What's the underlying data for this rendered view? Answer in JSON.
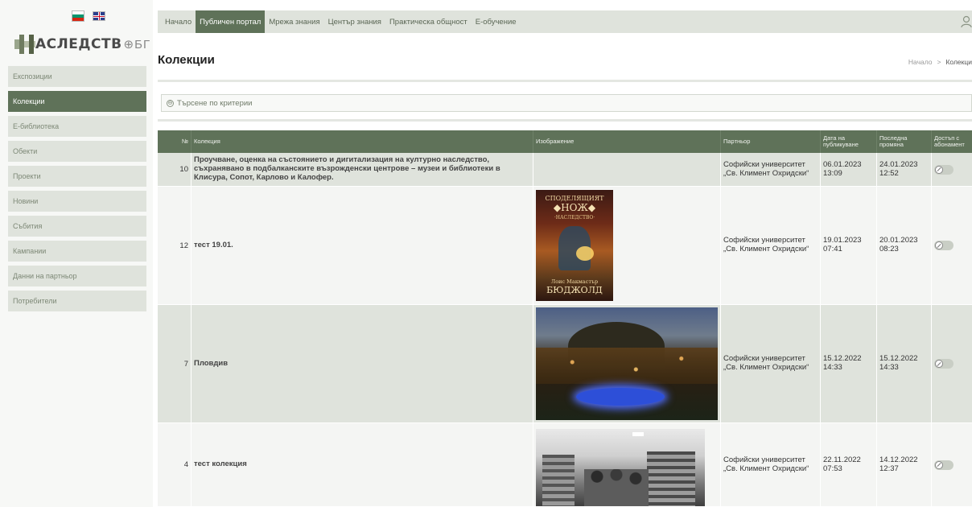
{
  "flags": {
    "bg": "BG",
    "uk": "EN"
  },
  "logo": {
    "text": "АСЛЕДСТВ",
    "suffix": "БГ"
  },
  "sidebar": {
    "items": [
      {
        "label": "Експозиции",
        "active": false
      },
      {
        "label": "Колекции",
        "active": true
      },
      {
        "label": "Е-библиотека",
        "active": false
      },
      {
        "label": "Обекти",
        "active": false
      },
      {
        "label": "Проекти",
        "active": false
      },
      {
        "label": "Новини",
        "active": false
      },
      {
        "label": "Събития",
        "active": false
      },
      {
        "label": "Кампании",
        "active": false
      },
      {
        "label": "Данни на партньор",
        "active": false
      },
      {
        "label": "Потребители",
        "active": false
      }
    ]
  },
  "topnav": {
    "tabs": [
      {
        "label": "Начало",
        "active": false
      },
      {
        "label": "Публичен портал",
        "active": true
      },
      {
        "label": "Мрежа знания",
        "active": false
      },
      {
        "label": "Център знания",
        "active": false
      },
      {
        "label": "Практическа общност",
        "active": false
      },
      {
        "label": "Е-обучение",
        "active": false
      }
    ]
  },
  "page": {
    "title": "Колекции",
    "breadcrumb": {
      "home": "Начало",
      "sep": ">",
      "current": "Колекци"
    }
  },
  "search": {
    "label": "Търсене по критерии",
    "icon": "⊖"
  },
  "table": {
    "headers": {
      "num": "№",
      "collection": "Колекция",
      "image": "Изображение",
      "partner": "Партньор",
      "published": "Дата на публикуване",
      "modified": "Последна промяна",
      "access": "Достъп с абонамент"
    },
    "rows": [
      {
        "num": "10",
        "collection": "Проучване, оценка на състоянието и дигитализация на културно наследство, съхранявано в подбалканските възрожденски центрове – музеи и библиотеки в Клисура, Сопот, Карлово и Калофер.",
        "image": "",
        "partner": "Софийски университет „Св. Климент Охридски“",
        "published": "06.01.2023 13:09",
        "modified": "24.01.2023 12:52",
        "access": false
      },
      {
        "num": "12",
        "collection": "тест 19.01.",
        "image": "book-cover",
        "partner": "Софийски университет „Св. Климент Охридски“",
        "published": "19.01.2023 07:41",
        "modified": "20.01.2023 08:23",
        "access": false
      },
      {
        "num": "7",
        "collection": "Пловдив",
        "image": "city-night",
        "partner": "Софийски университет „Св. Климент Охридски“",
        "published": "15.12.2022 14:33",
        "modified": "15.12.2022 14:33",
        "access": false
      },
      {
        "num": "4",
        "collection": "тест колекция",
        "image": "library-photo",
        "partner": "Софийски университет „Св. Климент Охридски“",
        "published": "22.11.2022 07:53",
        "modified": "14.12.2022 12:37",
        "access": false
      }
    ]
  },
  "book": {
    "line1": "СПОДЕЛЯЩИЯТ",
    "line2": "◆НОЖ◆",
    "line3": "·НАСЛЕДСТВО·",
    "author1": "Лоис Макмастър",
    "author2": "БЮДЖОЛД"
  },
  "colors": {
    "accent": "#5f7259",
    "nav_bg": "#dfe3dc",
    "row_odd": "#dfe3dc",
    "row_even": "#f4f5f3"
  }
}
